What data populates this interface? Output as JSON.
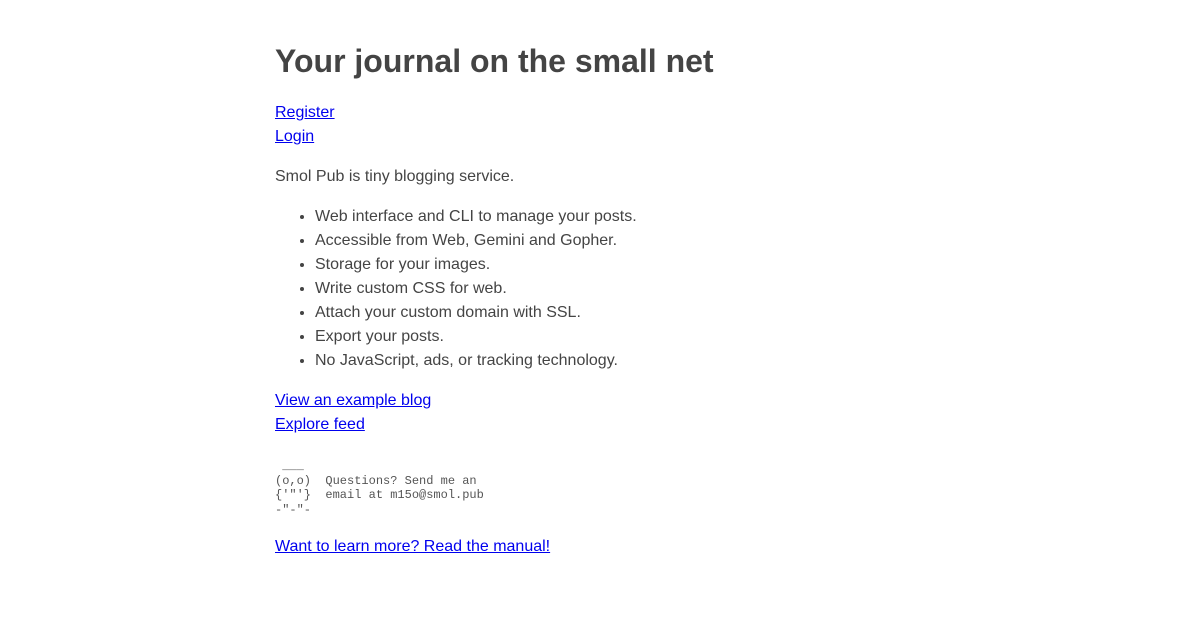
{
  "page": {
    "title": "Your journal on the small net"
  },
  "auth": {
    "register_label": "Register",
    "login_label": "Login"
  },
  "intro": "Smol Pub is tiny blogging service.",
  "features": [
    "Web interface and CLI to manage your posts.",
    "Accessible from Web, Gemini and Gopher.",
    "Storage for your images.",
    "Write custom CSS for web.",
    "Attach your custom domain with SSL.",
    "Export your posts.",
    "No JavaScript, ads, or tracking technology."
  ],
  "explore": {
    "example_blog_label": "View an example blog",
    "feed_label": "Explore feed"
  },
  "ascii_art": " ___\n(o,o)  Questions? Send me an\n{'\"'}  email at m15o@smol.pub\n-\"-\"-",
  "manual_label": "Want to learn more? Read the manual!",
  "colors": {
    "link": "#0000ee",
    "text": "#444444",
    "background": "#ffffff"
  }
}
